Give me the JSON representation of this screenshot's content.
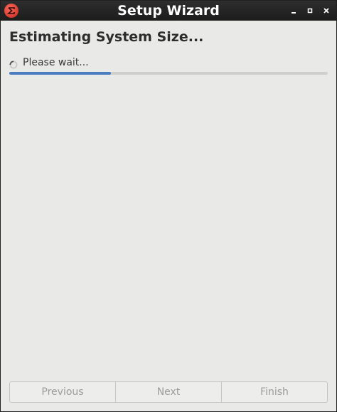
{
  "window": {
    "title": "Setup Wizard",
    "app_icon": "sigma-app-icon",
    "controls": [
      "minimize-icon",
      "maximize-icon",
      "close-icon"
    ]
  },
  "page": {
    "title": "Estimating System Size...",
    "status_icon": "spinner-icon",
    "status_text": "Please wait...",
    "progress_fraction": 0.32
  },
  "buttons": {
    "previous": "Previous",
    "next": "Next",
    "finish": "Finish",
    "enabled": false
  },
  "colors": {
    "accent": "#4a7cc0",
    "background": "#e9e9e7",
    "titlebar": "#1c1c1c",
    "disabled_text": "#9c9c9a"
  }
}
